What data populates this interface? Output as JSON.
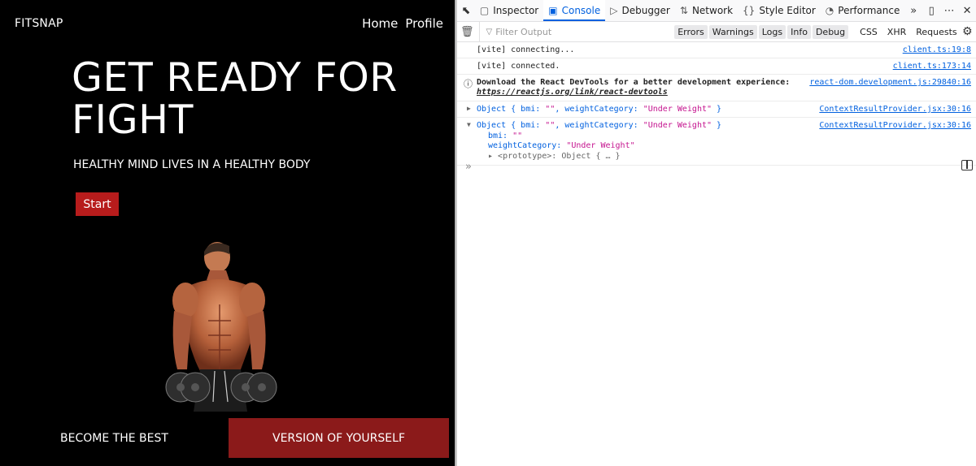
{
  "app": {
    "brand": "FITSNAP",
    "nav": [
      "Home",
      "Profile"
    ],
    "hero_title": "GET READY FOR FIGHT",
    "hero_subtitle": "HEALTHY MIND LIVES IN A HEALTHY BODY",
    "start_label": "Start",
    "footer_left": "BECOME THE BEST",
    "footer_right": "VERSION OF YOURSELF"
  },
  "devtools": {
    "tabs": [
      {
        "label": "Inspector",
        "icon": "inspector-icon"
      },
      {
        "label": "Console",
        "icon": "console-icon"
      },
      {
        "label": "Debugger",
        "icon": "debugger-icon"
      },
      {
        "label": "Network",
        "icon": "network-icon"
      },
      {
        "label": "Style Editor",
        "icon": "style-editor-icon"
      },
      {
        "label": "Performance",
        "icon": "performance-icon"
      }
    ],
    "filter_placeholder": "Filter Output",
    "levels": [
      "Errors",
      "Warnings",
      "Logs",
      "Info",
      "Debug"
    ],
    "net_filters": [
      "CSS",
      "XHR",
      "Requests"
    ],
    "messages": {
      "m1": {
        "text": "[vite] connecting...",
        "source": "client.ts:19:8"
      },
      "m2": {
        "text": "[vite] connected.",
        "source": "client.ts:173:14"
      },
      "m3": {
        "text": "Download the React DevTools for a better development experience: ",
        "link": "https://reactjs.org/link/react-devtools",
        "source": "react-dom.development.js:29840:16"
      },
      "m4": {
        "prefix": "Object { bmi: ",
        "bmi": "\"\"",
        "mid": ", weightCategory: ",
        "cat": "\"Under Weight\"",
        "suffix": " }",
        "source": "ContextResultProvider.jsx:30:16"
      },
      "m5": {
        "prefix": "Object { bmi: ",
        "bmi": "\"\"",
        "mid": ", weightCategory: ",
        "cat": "\"Under Weight\"",
        "suffix": " }",
        "source": "ContextResultProvider.jsx:30:16",
        "bmi_key": "bmi: ",
        "bmi_val": "\"\"",
        "cat_key": "weightCategory: ",
        "cat_val": "\"Under Weight\"",
        "proto": "<prototype>: Object { … }"
      }
    }
  }
}
